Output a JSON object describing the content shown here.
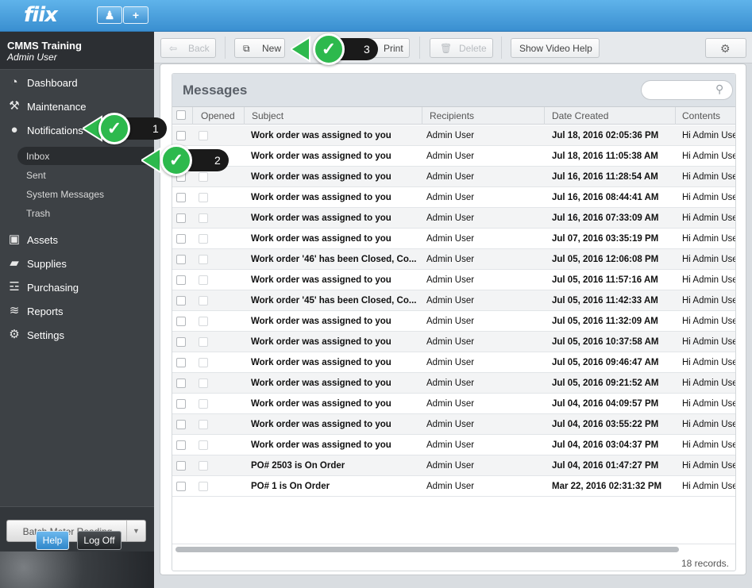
{
  "app": {
    "logo": "fiix",
    "accent": "#3a8fd0"
  },
  "topbar": {
    "user_icon": "user-icon",
    "add_icon": "plus-icon",
    "add_label": "+"
  },
  "sidebar": {
    "company": "CMMS Training",
    "role": "Admin User",
    "items": [
      {
        "label": "Dashboard",
        "icon": "dashboard-icon"
      },
      {
        "label": "Maintenance",
        "icon": "tools-icon"
      },
      {
        "label": "Notifications",
        "icon": "chat-bubble-icon"
      },
      {
        "label": "Assets",
        "icon": "boxes-icon"
      },
      {
        "label": "Supplies",
        "icon": "truck-icon"
      },
      {
        "label": "Purchasing",
        "icon": "cart-icon"
      },
      {
        "label": "Reports",
        "icon": "chart-icon"
      },
      {
        "label": "Settings",
        "icon": "gear-icon"
      }
    ],
    "subitems": [
      "Inbox",
      "Sent",
      "System Messages",
      "Trash"
    ],
    "batch_label": "Batch Meter Reading",
    "help_label": "Help",
    "logoff_label": "Log Off"
  },
  "toolbar": {
    "back": "Back",
    "new": "New",
    "print": "Print",
    "delete": "Delete",
    "video_help": "Show Video Help"
  },
  "messages": {
    "title": "Messages",
    "search_placeholder": "",
    "columns": [
      "Opened",
      "Subject",
      "Recipients",
      "Date Created",
      "Contents"
    ],
    "rows": [
      {
        "subject": "Work order was assigned to you",
        "recipients": "Admin User",
        "date": "Jul 18, 2016 02:05:36 PM",
        "contents": "Hi Admin User"
      },
      {
        "subject": "Work order was assigned to you",
        "recipients": "Admin User",
        "date": "Jul 18, 2016 11:05:38 AM",
        "contents": "Hi Admin User"
      },
      {
        "subject": "Work order was assigned to you",
        "recipients": "Admin User",
        "date": "Jul 16, 2016 11:28:54 AM",
        "contents": "Hi Admin User"
      },
      {
        "subject": "Work order was assigned to you",
        "recipients": "Admin User",
        "date": "Jul 16, 2016 08:44:41 AM",
        "contents": "Hi Admin User"
      },
      {
        "subject": "Work order was assigned to you",
        "recipients": "Admin User",
        "date": "Jul 16, 2016 07:33:09 AM",
        "contents": "Hi Admin User"
      },
      {
        "subject": "Work order was assigned to you",
        "recipients": "Admin User",
        "date": "Jul 07, 2016 03:35:19 PM",
        "contents": "Hi Admin User"
      },
      {
        "subject": "Work order '46' has been Closed, Co...",
        "recipients": "Admin User",
        "date": "Jul 05, 2016 12:06:08 PM",
        "contents": "Hi Admin User"
      },
      {
        "subject": "Work order was assigned to you",
        "recipients": "Admin User",
        "date": "Jul 05, 2016 11:57:16 AM",
        "contents": "Hi Admin User"
      },
      {
        "subject": "Work order '45' has been Closed, Co...",
        "recipients": "Admin User",
        "date": "Jul 05, 2016 11:42:33 AM",
        "contents": "Hi Admin User"
      },
      {
        "subject": "Work order was assigned to you",
        "recipients": "Admin User",
        "date": "Jul 05, 2016 11:32:09 AM",
        "contents": "Hi Admin User"
      },
      {
        "subject": "Work order was assigned to you",
        "recipients": "Admin User",
        "date": "Jul 05, 2016 10:37:58 AM",
        "contents": "Hi Admin User"
      },
      {
        "subject": "Work order was assigned to you",
        "recipients": "Admin User",
        "date": "Jul 05, 2016 09:46:47 AM",
        "contents": "Hi Admin User"
      },
      {
        "subject": "Work order was assigned to you",
        "recipients": "Admin User",
        "date": "Jul 05, 2016 09:21:52 AM",
        "contents": "Hi Admin User"
      },
      {
        "subject": "Work order was assigned to you",
        "recipients": "Admin User",
        "date": "Jul 04, 2016 04:09:57 PM",
        "contents": "Hi Admin User"
      },
      {
        "subject": "Work order was assigned to you",
        "recipients": "Admin User",
        "date": "Jul 04, 2016 03:55:22 PM",
        "contents": "Hi Admin User"
      },
      {
        "subject": "Work order was assigned to you",
        "recipients": "Admin User",
        "date": "Jul 04, 2016 03:04:37 PM",
        "contents": "Hi Admin User"
      },
      {
        "subject": "PO# 2503 is On Order",
        "recipients": "Admin User",
        "date": "Jul 04, 2016 01:47:27 PM",
        "contents": "Hi Admin User"
      },
      {
        "subject": "PO# 1 is On Order",
        "recipients": "Admin User",
        "date": "Mar 22, 2016 02:31:32 PM",
        "contents": "Hi Admin User"
      }
    ],
    "records_label": "18 records."
  },
  "callouts": [
    {
      "number": "1",
      "icon": "check-icon"
    },
    {
      "number": "2",
      "icon": "check-icon"
    },
    {
      "number": "3",
      "icon": "check-icon"
    }
  ]
}
